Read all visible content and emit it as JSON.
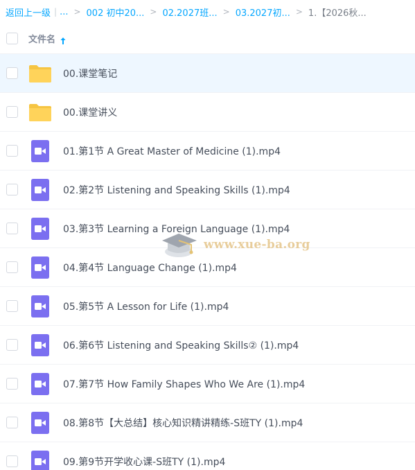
{
  "breadcrumb": {
    "back": "返回上一级",
    "ellipsis": "...",
    "items": [
      "002 初中20...",
      "02.2027班...",
      "03.2027初..."
    ],
    "current": "1.【2026秋..."
  },
  "header": {
    "name_label": "文件名",
    "sort_icon": "arrow-up-icon"
  },
  "files": [
    {
      "name": "00.课堂笔记",
      "type": "folder"
    },
    {
      "name": "00.课堂讲义",
      "type": "folder"
    },
    {
      "name": "01.第1节 A Great Master of Medicine (1).mp4",
      "type": "video"
    },
    {
      "name": "02.第2节 Listening and Speaking Skills (1).mp4",
      "type": "video"
    },
    {
      "name": "03.第3节 Learning a Foreign Language (1).mp4",
      "type": "video"
    },
    {
      "name": "04.第4节 Language Change (1).mp4",
      "type": "video"
    },
    {
      "name": "05.第5节 A Lesson for Life (1).mp4",
      "type": "video"
    },
    {
      "name": "06.第6节 Listening and Speaking Skills② (1).mp4",
      "type": "video"
    },
    {
      "name": "07.第7节 How Family Shapes Who We Are (1).mp4",
      "type": "video"
    },
    {
      "name": "08.第8节【大总结】核心知识精讲精练-S班TY (1).mp4",
      "type": "video"
    },
    {
      "name": "09.第9节开学收心课-S班TY (1).mp4",
      "type": "video"
    }
  ],
  "watermark": {
    "text": "www.xue-ba.org"
  },
  "colors": {
    "accent": "#06a7ff",
    "folder": "#ffd35a",
    "video": "#7b6ff0",
    "hover_row": "#eef7ff"
  }
}
